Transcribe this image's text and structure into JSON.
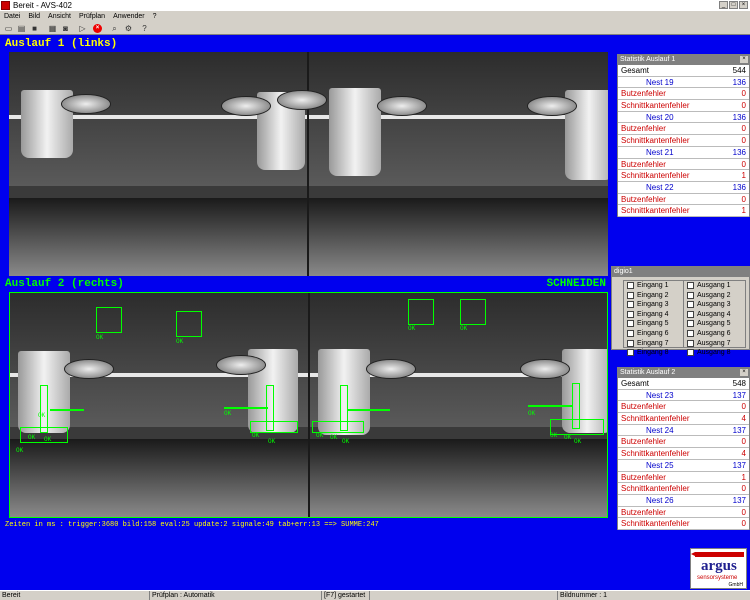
{
  "window": {
    "title": "Bereit - AVS-402"
  },
  "menu": [
    "Datei",
    "Bild",
    "Ansicht",
    "Prüfplan",
    "Anwender",
    "?"
  ],
  "toolbar": {
    "icons": [
      "new-icon",
      "open-icon",
      "save-icon",
      "image-icon",
      "camera-icon",
      "run-icon",
      "stop-icon",
      "zoom-icon",
      "settings-icon",
      "help-icon"
    ]
  },
  "cam1": {
    "title": "Auslauf 1 (links)"
  },
  "cam2": {
    "title": "Auslauf 2 (rechts)",
    "status": "SCHNEIDEN",
    "ok_label": "OK",
    "info": "Zeiten in ms : trigger:3680  bild:158  eval:25  update:2  signale:49  tab+err:13  ==>  SUMME:247"
  },
  "stat1": {
    "title": "Statistik Auslauf 1",
    "total_label": "Gesamt",
    "total": "544",
    "nests": [
      {
        "name": "Nest 19",
        "count": "136",
        "butzen_label": "Butzenfehler",
        "butzen": "0",
        "schnitt_label": "Schnittkantenfehler",
        "schnitt": "0"
      },
      {
        "name": "Nest 20",
        "count": "136",
        "butzen_label": "Butzenfehler",
        "butzen": "0",
        "schnitt_label": "Schnittkantenfehler",
        "schnitt": "0"
      },
      {
        "name": "Nest 21",
        "count": "136",
        "butzen_label": "Butzenfehler",
        "butzen": "0",
        "schnitt_label": "Schnittkantenfehler",
        "schnitt": "1"
      },
      {
        "name": "Nest 22",
        "count": "136",
        "butzen_label": "Butzenfehler",
        "butzen": "0",
        "schnitt_label": "Schnittkantenfehler",
        "schnitt": "1"
      }
    ]
  },
  "digio": {
    "title": "digio1",
    "inputs": [
      "Eingang 1",
      "Eingang 2",
      "Eingang 3",
      "Eingang 4",
      "Eingang 5",
      "Eingang 6",
      "Eingang 7",
      "Eingang 8"
    ],
    "outputs": [
      "Ausgang 1",
      "Ausgang 2",
      "Ausgang 3",
      "Ausgang 4",
      "Ausgang 5",
      "Ausgang 6",
      "Ausgang 7",
      "Ausgang 8"
    ]
  },
  "stat2": {
    "title": "Statistik Auslauf 2",
    "total_label": "Gesamt",
    "total": "548",
    "nests": [
      {
        "name": "Nest 23",
        "count": "137",
        "butzen_label": "Butzenfehler",
        "butzen": "0",
        "schnitt_label": "Schnittkantenfehler",
        "schnitt": "4"
      },
      {
        "name": "Nest 24",
        "count": "137",
        "butzen_label": "Butzenfehler",
        "butzen": "0",
        "schnitt_label": "Schnittkantenfehler",
        "schnitt": "4"
      },
      {
        "name": "Nest 25",
        "count": "137",
        "butzen_label": "Butzenfehler",
        "butzen": "1",
        "schnitt_label": "Schnittkantenfehler",
        "schnitt": "0"
      },
      {
        "name": "Nest 26",
        "count": "137",
        "butzen_label": "Butzenfehler",
        "butzen": "0",
        "schnitt_label": "Schnittkantenfehler",
        "schnitt": "0"
      }
    ]
  },
  "logo": {
    "name": "argus",
    "sub": "sensorsysteme",
    "suffix": "GmbH"
  },
  "statusbar": {
    "state": "Bereit",
    "plan": "Prüfplan : Automatik",
    "hint": "[F7] gestartet",
    "image": "Bildnummer : 1"
  },
  "colors": {
    "background": "#0000ee",
    "overlay_green": "#00ff00",
    "overlay_yellow": "#ffff00",
    "nest_blue": "#0000cc",
    "error_red": "#cc0000"
  }
}
